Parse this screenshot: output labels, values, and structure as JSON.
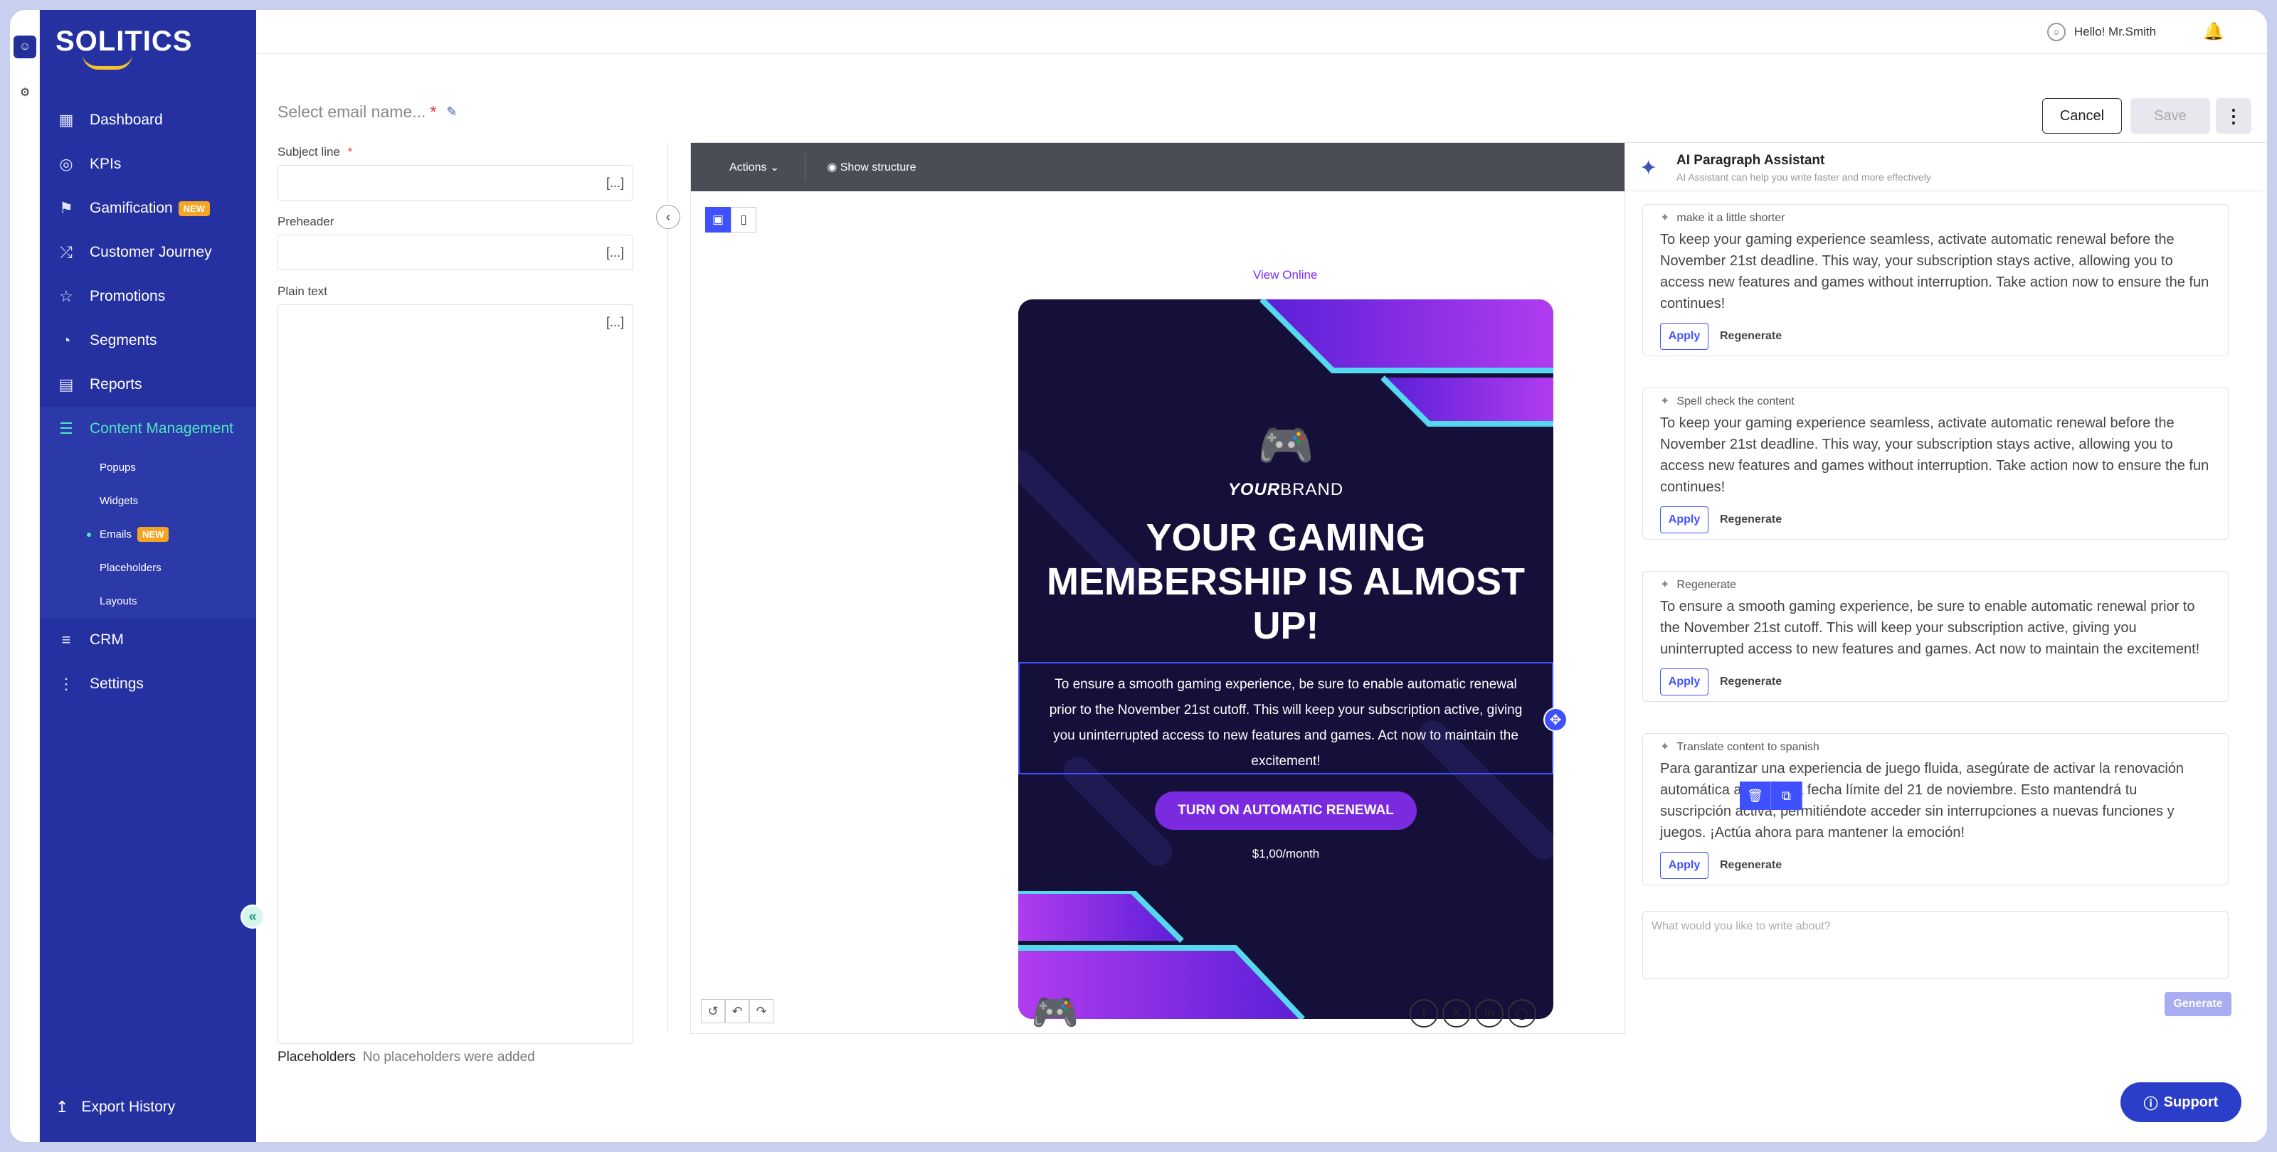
{
  "brand": {
    "logo": "SOLITICS"
  },
  "sidebar": {
    "items": [
      {
        "label": "Dashboard",
        "icon": "grid-icon"
      },
      {
        "label": "KPIs",
        "icon": "target-icon"
      },
      {
        "label": "Gamification",
        "icon": "flag-icon",
        "badge": "NEW"
      },
      {
        "label": "Customer Journey",
        "icon": "shuffle-icon"
      },
      {
        "label": "Promotions",
        "icon": "star-icon"
      },
      {
        "label": "Segments",
        "icon": "pie-icon"
      },
      {
        "label": "Reports",
        "icon": "file-icon"
      },
      {
        "label": "Content Management",
        "icon": "library-icon"
      }
    ],
    "sub_items": [
      {
        "label": "Popups"
      },
      {
        "label": "Widgets"
      },
      {
        "label": "Emails",
        "badge": "NEW"
      },
      {
        "label": "Placeholders"
      },
      {
        "label": "Layouts"
      }
    ],
    "items_after": [
      {
        "label": "CRM",
        "icon": "list-icon"
      },
      {
        "label": "Settings",
        "icon": "sliders-icon"
      }
    ],
    "export": "Export History"
  },
  "topbar": {
    "greeting": "Hello! Mr.Smith"
  },
  "editor": {
    "title": "Select email name...",
    "required": "*",
    "cancel": "Cancel",
    "save": "Save",
    "subject_label": "Subject line",
    "preheader_label": "Preheader",
    "plaintext_label": "Plain text",
    "bracket": "[...]",
    "placeholders_label": "Placeholders",
    "placeholders_value": "No placeholders were added",
    "actions": "Actions",
    "show_structure": "Show structure",
    "view_online": "View Online"
  },
  "email": {
    "brand_a": "YOUR",
    "brand_b": "BRAND",
    "headline": "YOUR GAMING MEMBERSHIP IS ALMOST UP!",
    "body": "To ensure a smooth gaming experience, be sure to enable automatic renewal prior to the November 21st cutoff. This will keep your subscription active, giving you uninterrupted access to new features and games. Act now to maintain the excitement!",
    "cta": "TURN ON AUTOMATIC RENEWAL",
    "price": "$1,00/month"
  },
  "ai": {
    "title": "AI Paragraph Assistant",
    "subtitle": "AI Assistant can help you write faster and more effectively",
    "cards": [
      {
        "prompt": "make it a little shorter",
        "text": "To keep your gaming experience seamless, activate automatic renewal before the November 21st deadline. This way, your subscription stays active, allowing you to access new features and games without interruption. Take action now to ensure the fun continues!"
      },
      {
        "prompt": "Spell check the content",
        "text": "To keep your gaming experience seamless, activate automatic renewal before the November 21st deadline. This way, your subscription stays active, allowing you to access new features and games without interruption. Take action now to ensure the fun continues!"
      },
      {
        "prompt": "Regenerate",
        "text": "To ensure a smooth gaming experience, be sure to enable automatic renewal prior to the November 21st cutoff. This will keep your subscription active, giving you uninterrupted access to new features and games. Act now to maintain the excitement!"
      },
      {
        "prompt": "Translate content to spanish",
        "text": "Para garantizar una experiencia de juego fluida, asegúrate de activar la renovación automática antes de la fecha límite del 21 de noviembre. Esto mantendrá tu suscripción activa, permitiéndote acceder sin interrupciones a nuevas funciones y juegos. ¡Actúa ahora para mantener la emoción!"
      }
    ],
    "apply": "Apply",
    "regenerate": "Regenerate",
    "input_placeholder": "What would you like to write about?",
    "generate": "Generate"
  },
  "support": "Support",
  "colors": {
    "sidebar": "#2531a0",
    "accent": "#3f51ff",
    "cta": "#7a2be0",
    "email_bg": "#14103a",
    "teal": "#4fe3c6"
  }
}
